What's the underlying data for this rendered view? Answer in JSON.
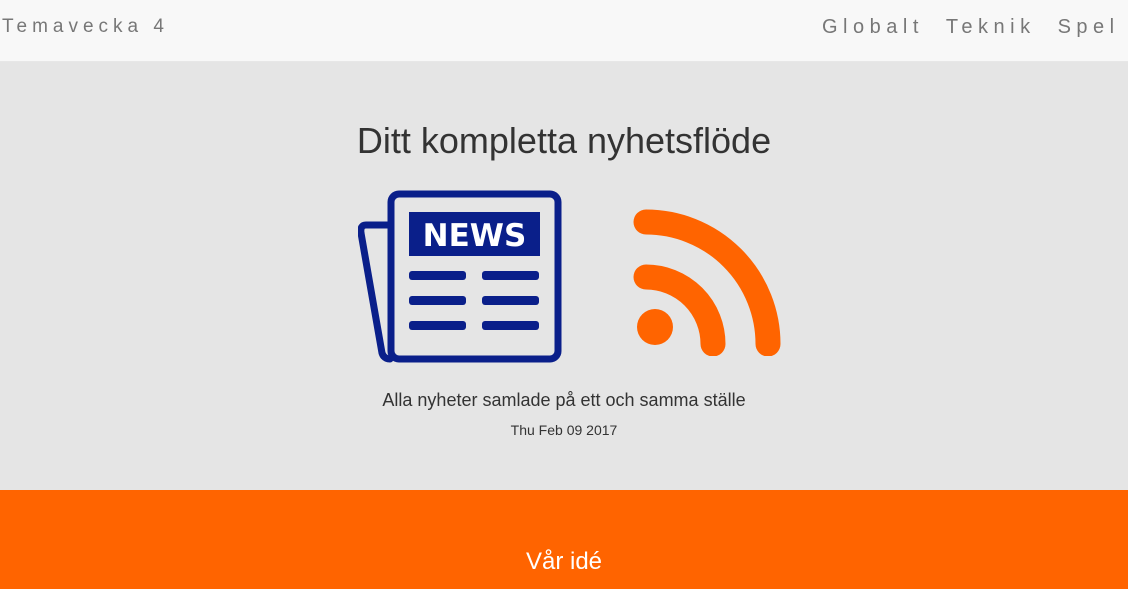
{
  "nav": {
    "brand": "Temavecka 4",
    "links": [
      "Globalt",
      "Teknik",
      "Spel"
    ]
  },
  "hero": {
    "title": "Ditt kompletta nyhetsflöde",
    "news_icon_text": "NEWS",
    "subtitle": "Alla nyheter samlade på ett och samma ställe",
    "date": "Thu Feb 09 2017"
  },
  "idea": {
    "title": "Vår idé"
  },
  "colors": {
    "navbar_bg": "#f8f8f8",
    "hero_bg": "#e5e5e5",
    "accent_orange": "#ff6400",
    "news_blue": "#0a1f8a"
  },
  "icons": {
    "news": "newspaper-icon",
    "rss": "rss-icon"
  }
}
